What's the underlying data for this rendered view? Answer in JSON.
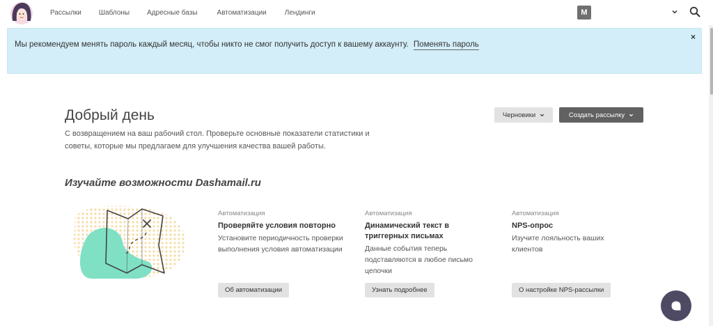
{
  "nav": {
    "items": [
      "Рассылки",
      "Шаблоны",
      "Адресные базы",
      "Автоматизации",
      "Лендинги"
    ],
    "avatar_letter": "М"
  },
  "alert": {
    "text": "Мы рекомендуем менять пароль каждый месяц, чтобы никто не смог получить доступ к вашему аккаунту.",
    "link": "Поменять пароль",
    "close": "×"
  },
  "greeting": {
    "title": "Добрый день",
    "subtitle": "С возвращением на ваш рабочий стол. Проверьте основные показатели статистики и советы, которые мы предлагаем для улучшения качества вашей работы."
  },
  "actions": {
    "drafts": "Черновики",
    "create": "Создать рассылку"
  },
  "features": {
    "title": "Изучайте возможности Dashamail.ru",
    "cards": [
      {
        "category": "Автоматизация",
        "title": "Проверяйте условия повторно",
        "description": "Установите периодичность проверки выполнения условия автоматизации",
        "button": "Об автоматизации"
      },
      {
        "category": "Автоматизация",
        "title": "Динамический текст в триггерных письмах",
        "description": "Данные события теперь подставляются в любое письмо цепочки",
        "button": "Узнать подробнее"
      },
      {
        "category": "Автоматизация",
        "title": "NPS-опрос",
        "description": "Изучите лояльность ваших клиентов",
        "button": "О настройке NPS-рассылки"
      }
    ]
  },
  "colors": {
    "alert_bg": "#d3eef8",
    "primary_button": "#616161",
    "secondary_button": "#e2e2e2",
    "chat_bubble": "#4f4a63",
    "illustration_accent": "#7fe0c4"
  }
}
